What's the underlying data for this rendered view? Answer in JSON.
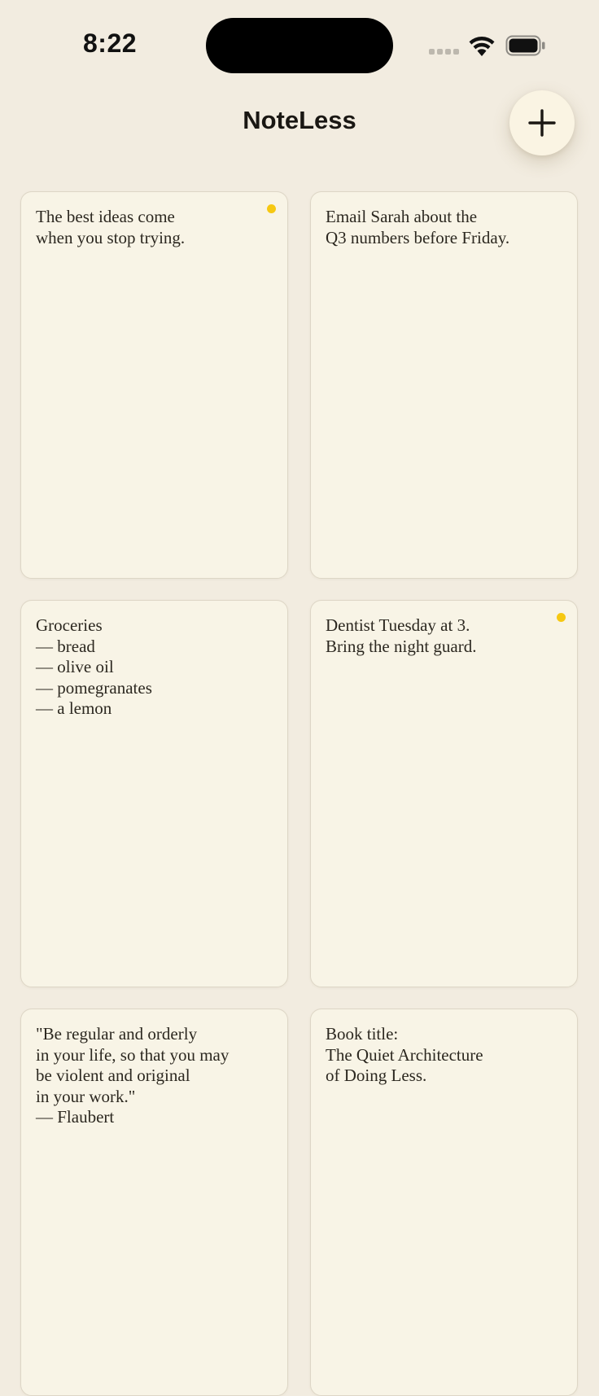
{
  "status_bar": {
    "time": "8:22"
  },
  "header": {
    "title": "NoteLess",
    "add_icon": "plus-icon"
  },
  "colors": {
    "background": "#f2ece0",
    "card": "#f8f4e6",
    "accent_dot": "#f6c812",
    "text": "#2c2820"
  },
  "notes": [
    {
      "text": "The best ideas come\nwhen you stop trying.",
      "flagged": true
    },
    {
      "text": "Email Sarah about the\nQ3 numbers before Friday.",
      "flagged": false
    },
    {
      "text": "Groceries\n— bread\n— olive oil\n— pomegranates\n— a lemon",
      "flagged": false
    },
    {
      "text": "Dentist Tuesday at 3.\nBring the night guard.",
      "flagged": true
    },
    {
      "text": "\"Be regular and orderly\nin your life, so that you may\nbe violent and original\nin your work.\"\n— Flaubert",
      "flagged": false
    },
    {
      "text": "Book title:\nThe Quiet Architecture\nof Doing Less.",
      "flagged": false
    }
  ]
}
